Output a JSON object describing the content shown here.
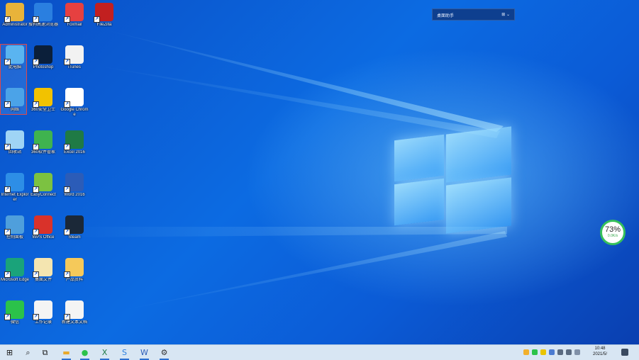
{
  "desktop": {
    "icons": [
      {
        "label": "Administrator",
        "icon": "user-folder-icon",
        "color": "#e8b33a"
      },
      {
        "label": "搜狗高速浏览器",
        "icon": "sogou-browser-icon",
        "color": "#2a7fe0"
      },
      {
        "label": "Foxmail",
        "icon": "foxmail-icon",
        "color": "#e64040"
      },
      {
        "label": "FileZilla",
        "icon": "filezilla-icon",
        "color": "#c22020"
      },
      {
        "label": "此电脑",
        "icon": "this-pc-icon",
        "color": "#5ab4f0"
      },
      {
        "label": "Photoshop",
        "icon": "photoshop-icon",
        "color": "#0b1f3a"
      },
      {
        "label": "iTunes",
        "icon": "itunes-icon",
        "color": "#f2f2f2"
      },
      {
        "label": "网络",
        "icon": "network-icon",
        "color": "#4ba3e8"
      },
      {
        "label": "360安全卫士",
        "icon": "360-security-icon",
        "color": "#f2c200"
      },
      {
        "label": "Google Chrome",
        "icon": "chrome-icon",
        "color": "#ffffff"
      },
      {
        "label": "回收站",
        "icon": "recycle-bin-icon",
        "color": "#9fd4f5"
      },
      {
        "label": "360软件管家",
        "icon": "360-software-icon",
        "color": "#3fb34f"
      },
      {
        "label": "Excel 2016",
        "icon": "excel-icon",
        "color": "#1f7a45"
      },
      {
        "label": "Internet Explorer",
        "icon": "internet-explorer-icon",
        "color": "#2d8ee6"
      },
      {
        "label": "EasyConnect",
        "icon": "easyconnect-icon",
        "color": "#7cc241"
      },
      {
        "label": "Word 2016",
        "icon": "word-icon",
        "color": "#2b5cb8"
      },
      {
        "label": "控制面板",
        "icon": "control-panel-icon",
        "color": "#4f9fdc"
      },
      {
        "label": "WPS Office",
        "icon": "wps-icon",
        "color": "#d9322a"
      },
      {
        "label": "Steam",
        "icon": "steam-icon",
        "color": "#1b2838"
      },
      {
        "label": "Microsoft Edge",
        "icon": "edge-icon",
        "color": "#1aa37a"
      },
      {
        "label": "桌面文件",
        "icon": "document-icon",
        "color": "#f4e5b0"
      },
      {
        "label": "产品资料",
        "icon": "folder-icon",
        "color": "#f5c95a"
      },
      {
        "label": "微信",
        "icon": "wechat-icon",
        "color": "#2bc24a"
      },
      {
        "label": "工作记录",
        "icon": "text-file-icon",
        "color": "#f4f4f4"
      },
      {
        "label": "新建文本文档",
        "icon": "notepad-icon",
        "color": "#f4f4f4"
      }
    ],
    "search_widget": {
      "label": "桌面助手",
      "right": "⊞ ⌄"
    },
    "gauge": {
      "value": "73%",
      "sub": "0.0K/s"
    }
  },
  "taskbar": {
    "items": [
      {
        "name": "start-icon"
      },
      {
        "name": "search-icon"
      },
      {
        "name": "task-view-icon"
      },
      {
        "name": "file-explorer-icon",
        "active": true
      },
      {
        "name": "wechat-taskbar-icon",
        "active": true
      },
      {
        "name": "excel-taskbar-icon",
        "active": true
      },
      {
        "name": "sogou-taskbar-icon",
        "active": true
      },
      {
        "name": "word-taskbar-icon",
        "active": true
      },
      {
        "name": "settings-icon",
        "active": true
      }
    ],
    "clock": {
      "time": "10:48",
      "date": "2021/5/"
    }
  },
  "colors": {
    "accent": "#2a6fd1",
    "taskbar": "#d8e6f3",
    "selection": "#e04848"
  }
}
